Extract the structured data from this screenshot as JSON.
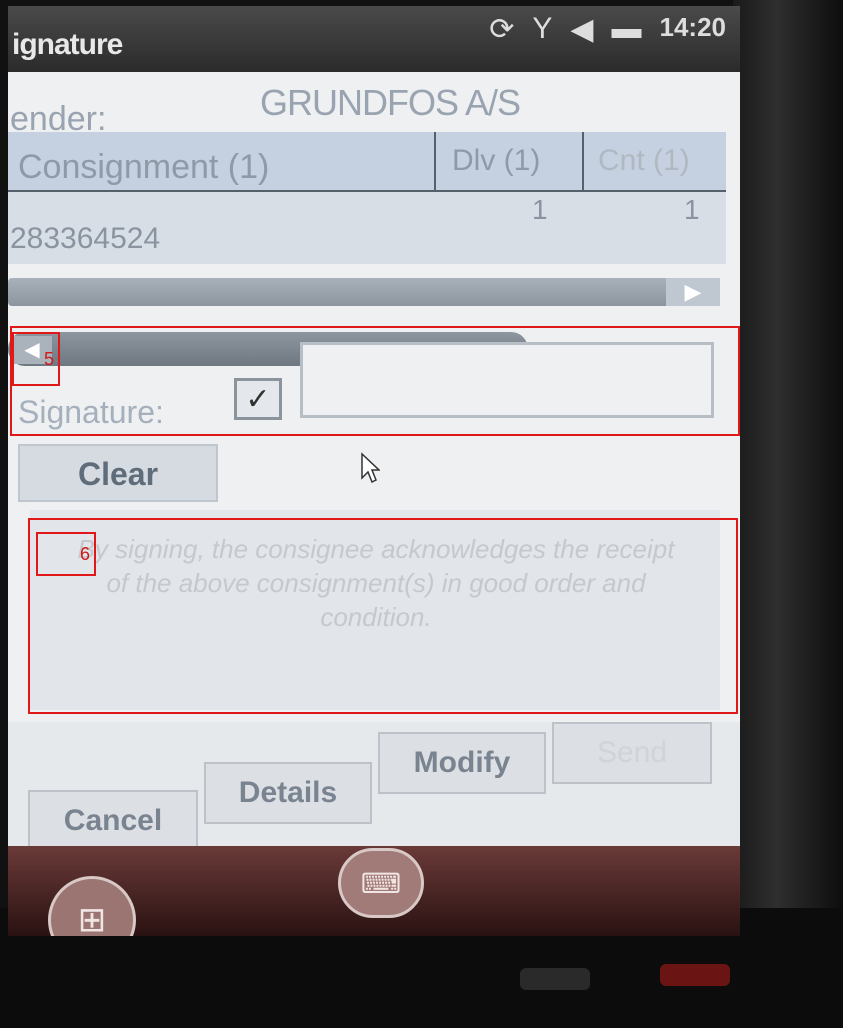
{
  "window": {
    "title": "ignature",
    "clock": "14:20"
  },
  "status_icons": [
    "sync-icon",
    "signal-icon",
    "volume-icon",
    "battery-icon"
  ],
  "sender": {
    "label": "ender:",
    "value": "GRUNDFOS A/S"
  },
  "grid": {
    "headers": [
      "Consignment (1)",
      "Dlv (1)",
      "Cnt (1)"
    ],
    "rows": [
      {
        "consignment": "283364524",
        "dlv": "1",
        "cnt": "1"
      }
    ]
  },
  "signature": {
    "label": "Signature:",
    "checkbox_checked": true,
    "checkbox_glyph": "✓"
  },
  "clear_label": "Clear",
  "disclaimer": "By signing, the consignee acknowledges the receipt of the above consignment(s) in good order and condition.",
  "buttons": {
    "cancel": "Cancel",
    "details": "Details",
    "modify": "Modify",
    "send": "Send"
  },
  "annotations": {
    "box5": "5",
    "box6": "6"
  },
  "colors": {
    "annotation": "#e01818"
  }
}
